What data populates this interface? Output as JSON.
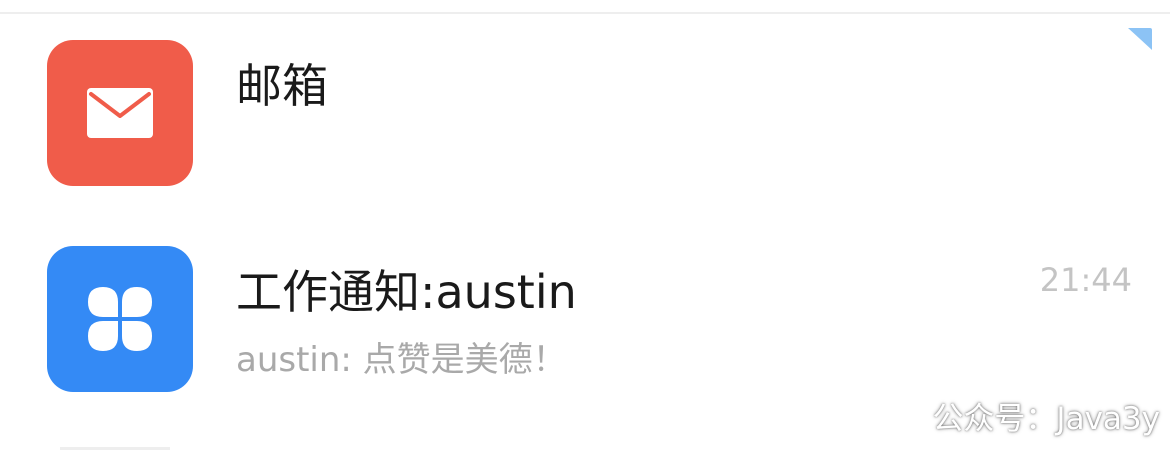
{
  "conversations": [
    {
      "title": "邮箱",
      "icon": "mail-icon",
      "icon_bg": "#f05c4a"
    },
    {
      "title": "工作通知:austin",
      "time": "21:44",
      "preview": "austin: 点赞是美德！",
      "icon": "clover-icon",
      "icon_bg": "#348af5"
    }
  ],
  "watermark": "公众号：Java3y",
  "unread_corner_color": "#8cc3f5"
}
